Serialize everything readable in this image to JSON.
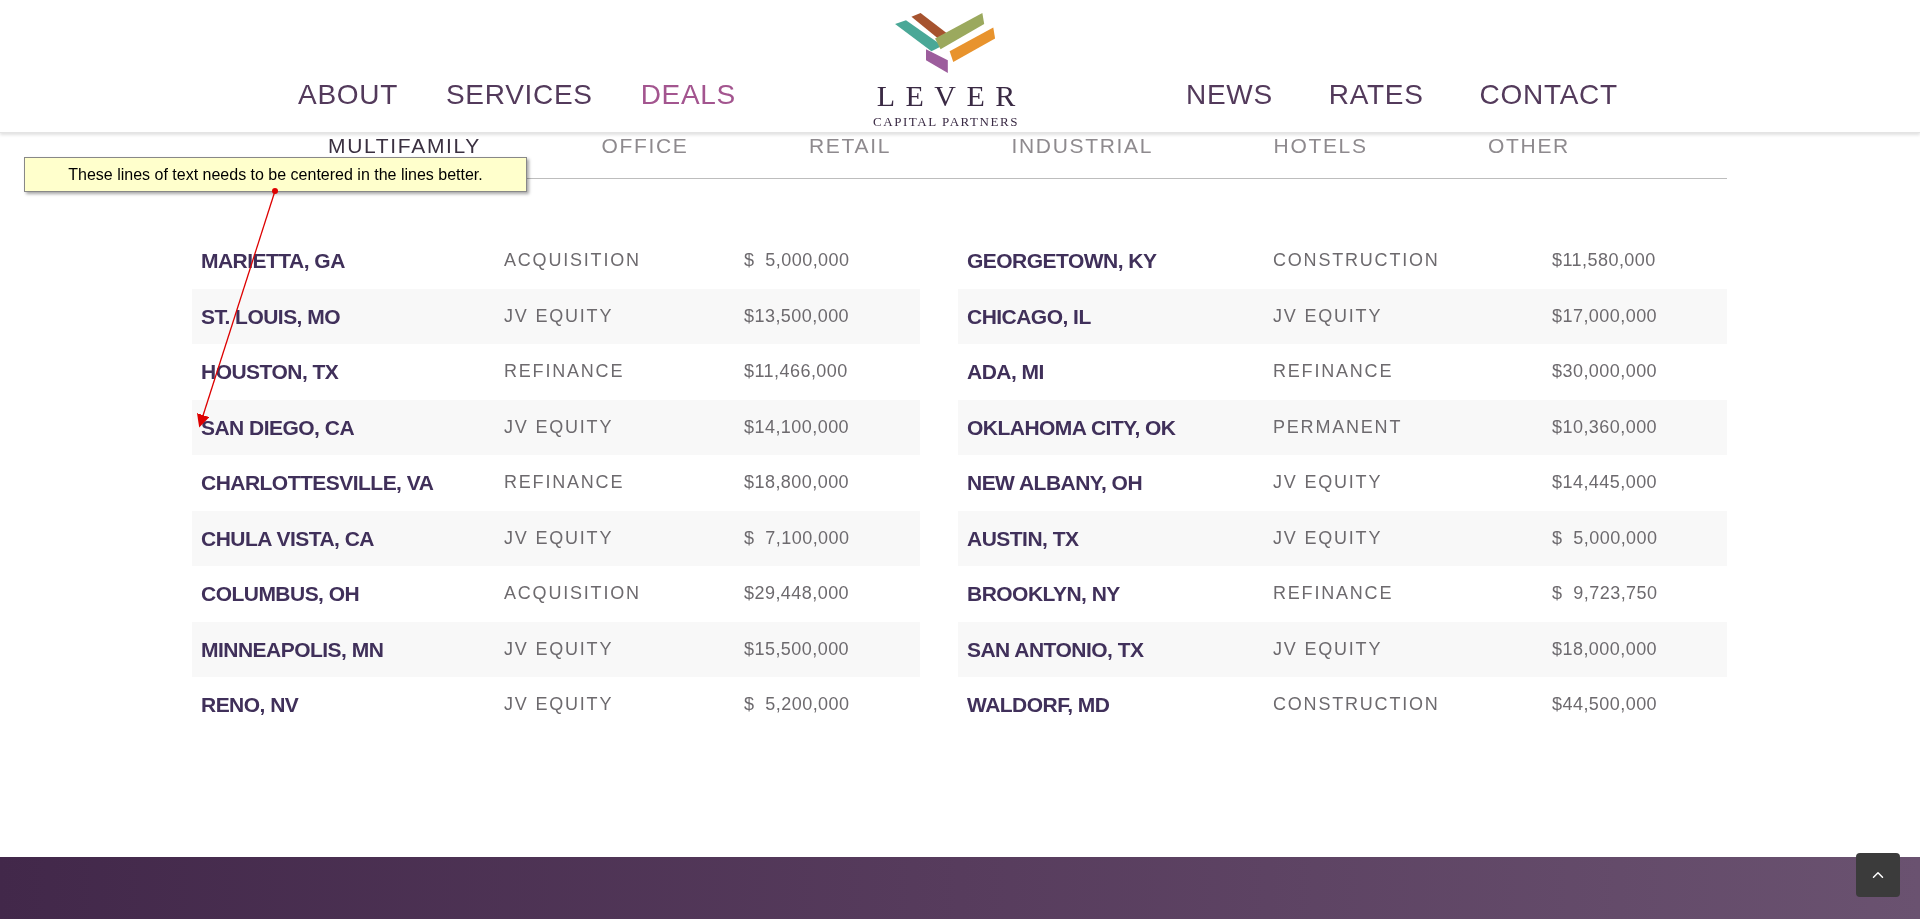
{
  "nav_left": [
    {
      "label": "ABOUT",
      "selected": false
    },
    {
      "label": "SERVICES",
      "selected": false
    },
    {
      "label": "DEALS",
      "selected": true
    }
  ],
  "logo": {
    "name": "LEVER",
    "tagline": "CAPITAL PARTNERS"
  },
  "nav_right": [
    {
      "label": "NEWS",
      "selected": false
    },
    {
      "label": "RATES",
      "selected": false
    },
    {
      "label": "CONTACT",
      "selected": false
    }
  ],
  "subtabs": [
    {
      "label": "MULTIFAMILY",
      "selected": true
    },
    {
      "label": "OFFICE",
      "selected": false
    },
    {
      "label": "RETAIL",
      "selected": false
    },
    {
      "label": "INDUSTRIAL",
      "selected": false
    },
    {
      "label": "HOTELS",
      "selected": false
    },
    {
      "label": "OTHER",
      "selected": false
    }
  ],
  "deal_tables": [
    {
      "rows": [
        {
          "location": "MARIETTA, GA",
          "type": "ACQUISITION",
          "amount": "$  5,000,000"
        },
        {
          "location": "ST. LOUIS, MO",
          "type": "JV EQUITY",
          "amount": "$13,500,000"
        },
        {
          "location": "HOUSTON, TX",
          "type": "REFINANCE",
          "amount": "$11,466,000"
        },
        {
          "location": "SAN DIEGO, CA",
          "type": "JV EQUITY",
          "amount": "$14,100,000"
        },
        {
          "location": "CHARLOTTESVILLE, VA",
          "type": "REFINANCE",
          "amount": "$18,800,000"
        },
        {
          "location": "CHULA VISTA, CA",
          "type": "JV EQUITY",
          "amount": "$  7,100,000"
        },
        {
          "location": "COLUMBUS, OH",
          "type": "ACQUISITION",
          "amount": "$29,448,000"
        },
        {
          "location": "MINNEAPOLIS, MN",
          "type": "JV EQUITY",
          "amount": "$15,500,000"
        },
        {
          "location": "RENO, NV",
          "type": "JV EQUITY",
          "amount": "$  5,200,000"
        }
      ]
    },
    {
      "rows": [
        {
          "location": "GEORGETOWN, KY",
          "type": "CONSTRUCTION",
          "amount": "$11,580,000"
        },
        {
          "location": "CHICAGO, IL",
          "type": "JV EQUITY",
          "amount": "$17,000,000"
        },
        {
          "location": "ADA, MI",
          "type": "REFINANCE",
          "amount": "$30,000,000"
        },
        {
          "location": "OKLAHOMA CITY, OK",
          "type": "PERMANENT",
          "amount": "$10,360,000"
        },
        {
          "location": "NEW ALBANY, OH",
          "type": "JV EQUITY",
          "amount": "$14,445,000"
        },
        {
          "location": "AUSTIN, TX",
          "type": "JV EQUITY",
          "amount": "$  5,000,000"
        },
        {
          "location": "BROOKLYN, NY",
          "type": "REFINANCE",
          "amount": "$  9,723,750"
        },
        {
          "location": "SAN ANTONIO, TX",
          "type": "JV EQUITY",
          "amount": "$18,000,000"
        },
        {
          "location": "WALDORF, MD",
          "type": "CONSTRUCTION",
          "amount": "$44,500,000"
        }
      ]
    }
  ],
  "annotation": {
    "text": "These lines of text needs to be centered in the lines better."
  }
}
